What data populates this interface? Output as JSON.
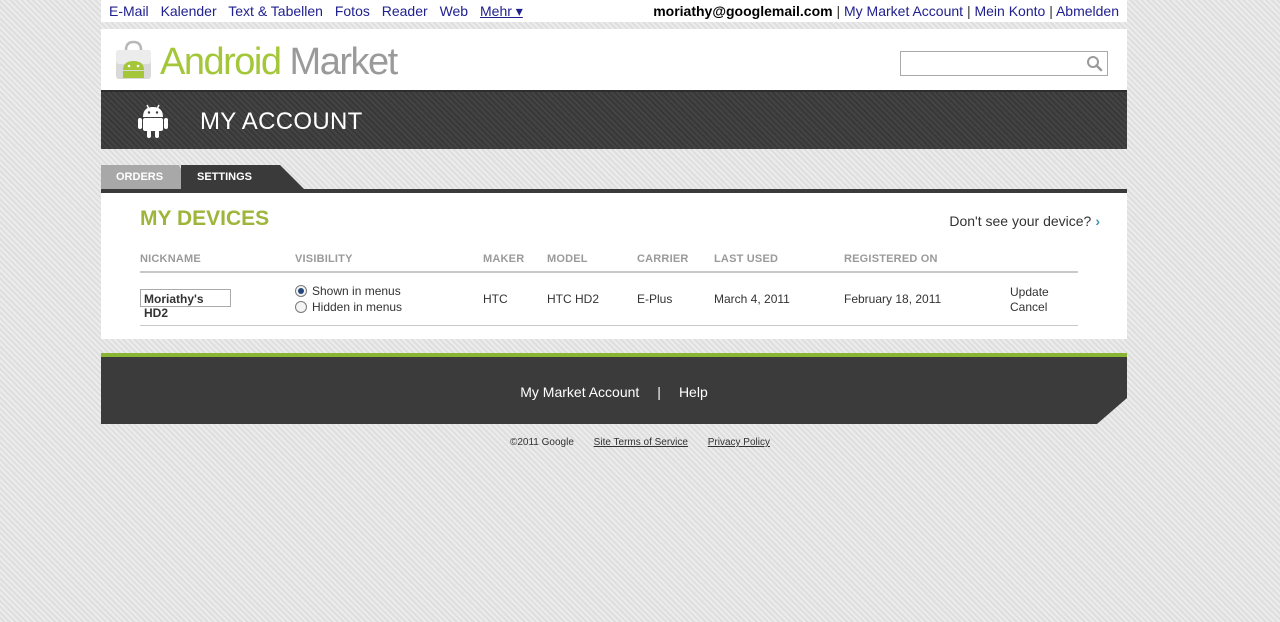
{
  "gbar": {
    "links": [
      "E-Mail",
      "Kalender",
      "Text & Tabellen",
      "Fotos",
      "Reader",
      "Web"
    ],
    "more": "Mehr ▾",
    "email": "moriathy@googlemail.com",
    "account_links": [
      "My Market Account",
      "Mein Konto",
      "Abmelden"
    ]
  },
  "header": {
    "logo_word1": "Android",
    "logo_word2": "Market",
    "search_placeholder": "",
    "search_icon": "search-icon"
  },
  "band": {
    "title": "MY ACCOUNT",
    "icon": "android-robot-icon"
  },
  "tabs": {
    "orders": "ORDERS",
    "settings": "SETTINGS",
    "active": "SETTINGS"
  },
  "devices": {
    "heading": "MY DEVICES",
    "dont_see": "Don't see your device?",
    "columns": [
      "NICKNAME",
      "VISIBILITY",
      "MAKER",
      "MODEL",
      "CARRIER",
      "LAST USED",
      "REGISTERED ON"
    ],
    "row": {
      "nickname": "Moriathy's HD2",
      "visibility_options": [
        "Shown in menus",
        "Hidden in menus"
      ],
      "visibility_selected": "Shown in menus",
      "maker": "HTC",
      "model": "HTC HD2",
      "carrier": "E-Plus",
      "last_used": "March 4, 2011",
      "registered_on": "February 18, 2011",
      "actions": [
        "Update",
        "Cancel"
      ]
    }
  },
  "footer": {
    "links": [
      "My Market Account",
      "Help"
    ],
    "separator": "|"
  },
  "legal": {
    "copyright": "©2011 Google",
    "links": [
      "Site Terms of Service",
      "Privacy Policy"
    ]
  },
  "colors": {
    "accent_green": "#a4c639",
    "heading_green": "#9db53a",
    "dark_band": "#3e3e3e",
    "link_blue": "#20208f"
  }
}
